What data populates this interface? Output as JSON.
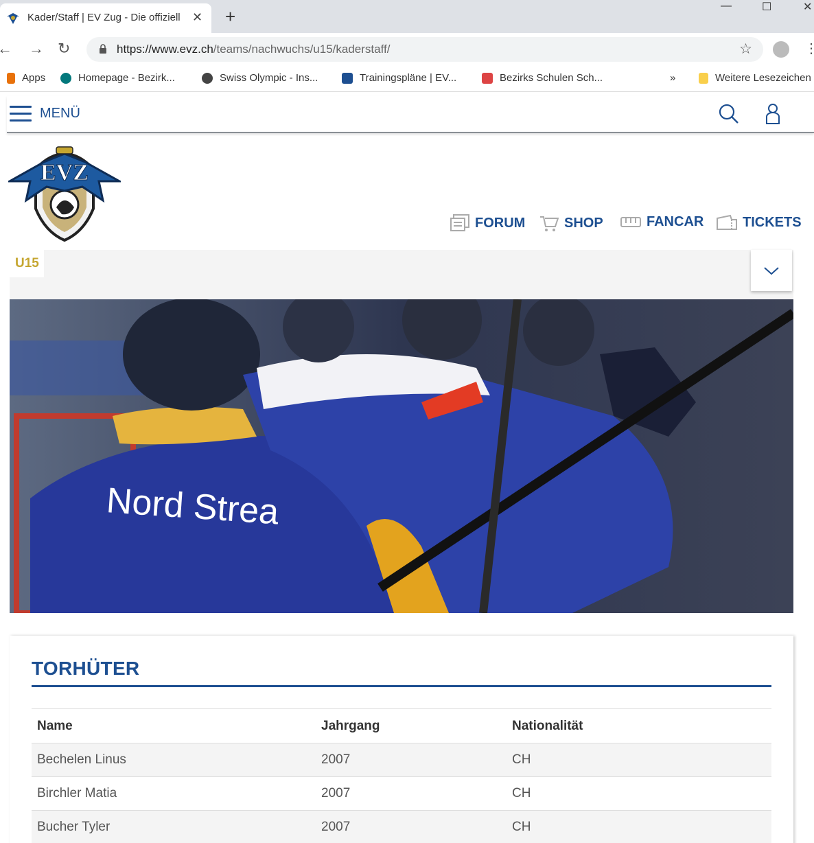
{
  "browser": {
    "tab_title": "Kader/Staff | EV Zug - Die offiziell",
    "tab_close": "✕",
    "new_tab": "+",
    "window_controls": {
      "minimize": "—",
      "maximize": "☐",
      "close": "✕"
    },
    "url_host": "https://www.evz.ch",
    "url_path": "/teams/nachwuchs/u15/kaderstaff/",
    "bookmarks": [
      {
        "label": "Apps",
        "icon": "apps-grid-icon",
        "color": "#e8710a"
      },
      {
        "label": "Homepage - Bezirk...",
        "icon": "sharepoint-icon",
        "color": "#03787c"
      },
      {
        "label": "Swiss Olympic - Ins...",
        "icon": "globe-icon",
        "color": "#444444"
      },
      {
        "label": "Trainingspläne | EV...",
        "icon": "evz-favicon",
        "color": "#1d4f91"
      },
      {
        "label": "Bezirks Schulen Sch...",
        "icon": "school-favicon",
        "color": "#d44"
      }
    ],
    "bookmarks_overflow": "»",
    "other_bookmarks": "Weitere Lesezeichen"
  },
  "site": {
    "menu_label": "MENÜ",
    "quicklinks": [
      {
        "label": "FORUM",
        "icon": "forum-icon"
      },
      {
        "label": "SHOP",
        "icon": "cart-icon"
      },
      {
        "label": "FANCAR",
        "icon": "bus-icon"
      },
      {
        "label": "TICKETS",
        "icon": "ticket-icon"
      }
    ],
    "team_label": "U15",
    "hero_text": "Nord Strea",
    "brand_color": "#1d4f91",
    "accent_color": "#c5a630"
  },
  "roster": {
    "section_title": "TORHÜTER",
    "columns": [
      "Name",
      "Jahrgang",
      "Nationalität"
    ],
    "rows": [
      [
        "Bechelen Linus",
        "2007",
        "CH"
      ],
      [
        "Birchler Matia",
        "2007",
        "CH"
      ],
      [
        "Bucher Tyler",
        "2007",
        "CH"
      ]
    ]
  }
}
